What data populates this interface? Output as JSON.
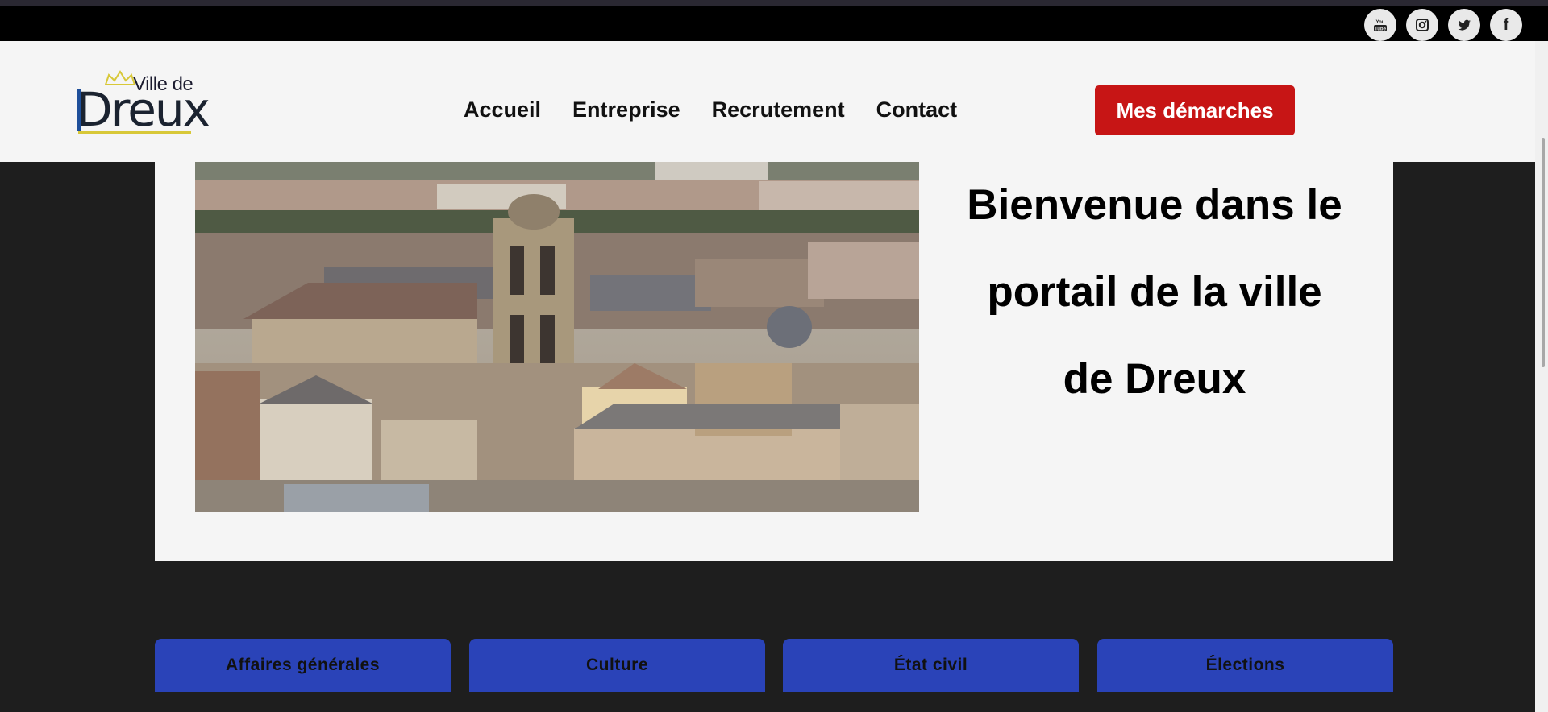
{
  "social": {
    "youtube_label": "You Tube",
    "instagram": "instagram-icon",
    "twitter": "twitter-icon",
    "facebook_label": "f"
  },
  "logo": {
    "line1": "Ville de",
    "line2": "Dreux"
  },
  "nav": {
    "items": [
      {
        "label": "Accueil"
      },
      {
        "label": "Entreprise"
      },
      {
        "label": "Recrutement"
      },
      {
        "label": "Contact"
      }
    ],
    "cta_label": "Mes démarches"
  },
  "hero": {
    "title": "Bienvenue dans le portail de la ville de Dreux"
  },
  "categories": [
    {
      "label": "Affaires générales"
    },
    {
      "label": "Culture"
    },
    {
      "label": "État civil"
    },
    {
      "label": "Élections"
    }
  ],
  "colors": {
    "accent_red": "#c71515",
    "card_blue": "#2a43b8",
    "logo_yellow": "#d8c838"
  }
}
